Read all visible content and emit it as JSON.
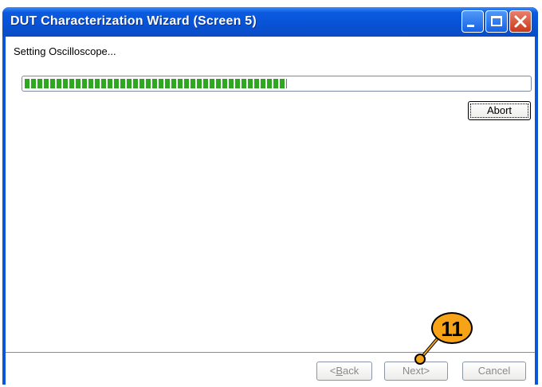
{
  "window": {
    "title": "DUT Characterization Wizard (Screen 5)",
    "controls": [
      "minimize-icon",
      "maximize-icon",
      "close-icon"
    ]
  },
  "status": {
    "text": "Setting Oscilloscope...",
    "progress_fraction": 0.52
  },
  "buttons": {
    "abort": "Abort",
    "back_prefix": "<",
    "back_key": "B",
    "back_rest": "ack",
    "next": "Next>",
    "cancel": "Cancel"
  },
  "callout": {
    "number": "11"
  },
  "colors": {
    "titlebar": "#0852d5",
    "progress": "#2ea81f",
    "callout": "#f6a317"
  }
}
